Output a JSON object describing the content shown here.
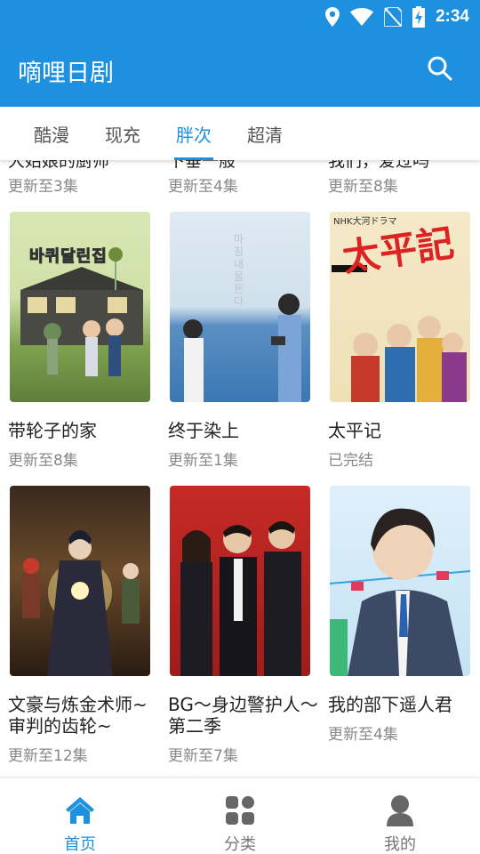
{
  "status_bar": {
    "time": "2:34"
  },
  "app_bar": {
    "title": "嘀哩日剧"
  },
  "tabs": [
    {
      "label": "酷漫",
      "active": false
    },
    {
      "label": "现充",
      "active": false
    },
    {
      "label": "胖次",
      "active": true
    },
    {
      "label": "超清",
      "active": false
    }
  ],
  "partial_row": [
    {
      "title": "大始娘的厨师",
      "status": "更新至3集"
    },
    {
      "title": "下垂一般",
      "status": "更新至4集"
    },
    {
      "title": "我们，爱过吗",
      "status": "更新至8集"
    }
  ],
  "cards": [
    {
      "title": "带轮子的家",
      "status": "更新至8集",
      "poster_text": "바퀴달린집"
    },
    {
      "title": "终于染上",
      "status": "更新至1集",
      "poster_text": "마침내 물든다"
    },
    {
      "title": "太平记",
      "status": "已完结",
      "poster_text": "太平記"
    },
    {
      "title": "文豪与炼金术师~审判的齿轮~",
      "status": "更新至12集",
      "poster_text": ""
    },
    {
      "title": "BG～身边警护人～ 第二季",
      "status": "更新至7集",
      "poster_text": ""
    },
    {
      "title": "我的部下遥人君",
      "status": "更新至4集",
      "poster_text": ""
    }
  ],
  "bottom_nav": [
    {
      "label": "首页",
      "active": true,
      "icon": "home-icon"
    },
    {
      "label": "分类",
      "active": false,
      "icon": "grid-icon"
    },
    {
      "label": "我的",
      "active": false,
      "icon": "person-icon"
    }
  ],
  "colors": {
    "primary": "#1e90e0",
    "muted_text": "#888888"
  }
}
